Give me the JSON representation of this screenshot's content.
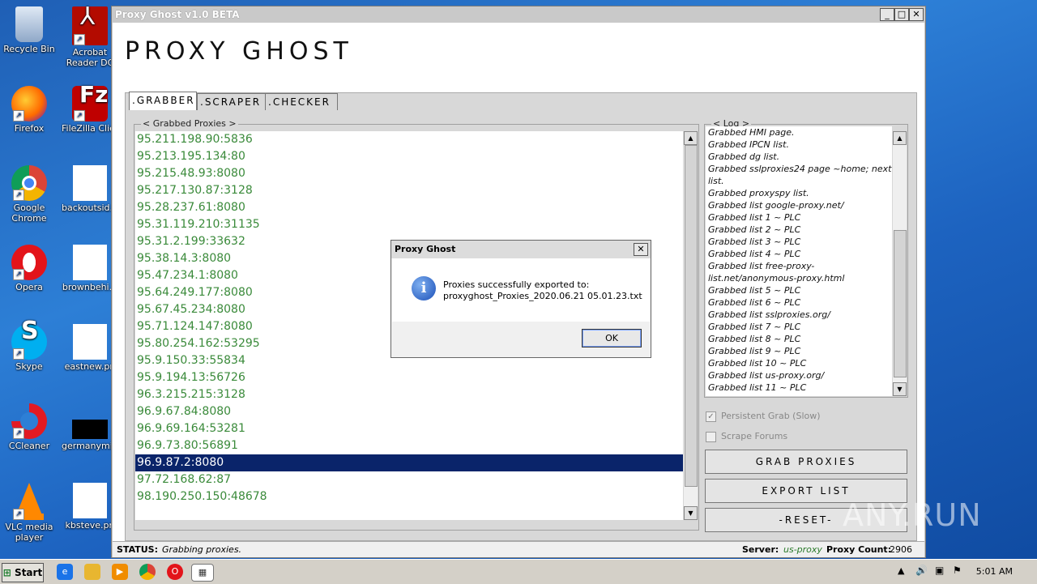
{
  "desktop": {
    "icons": [
      {
        "label": "Recycle Bin",
        "icon": "recycle-bin-icon"
      },
      {
        "label": "Acrobat Reader DC",
        "icon": "acrobat-icon"
      },
      {
        "label": "Firefox",
        "icon": "firefox-icon"
      },
      {
        "label": "FileZilla Client",
        "icon": "filezilla-icon"
      },
      {
        "label": "Google Chrome",
        "icon": "chrome-icon"
      },
      {
        "label": "backoutsid...",
        "icon": "file-icon"
      },
      {
        "label": "Opera",
        "icon": "opera-icon"
      },
      {
        "label": "brownbehi...",
        "icon": "file-icon"
      },
      {
        "label": "Skype",
        "icon": "skype-icon"
      },
      {
        "label": "eastnew.pn",
        "icon": "file-icon"
      },
      {
        "label": "CCleaner",
        "icon": "ccleaner-icon"
      },
      {
        "label": "germanymin...",
        "icon": "image-file-icon"
      },
      {
        "label": "VLC media player",
        "icon": "vlc-icon"
      },
      {
        "label": "kbsteve.pn",
        "icon": "file-icon"
      }
    ]
  },
  "window": {
    "title": "Proxy Ghost v1.0 BETA",
    "brand": "PROXY GHOST",
    "controls": {
      "minimize": "_",
      "maximize": "□",
      "close": "✕"
    }
  },
  "tabs": [
    {
      "label": ".GRABBER",
      "active": true
    },
    {
      "label": ".SCRAPER",
      "active": false
    },
    {
      "label": ".CHECKER",
      "active": false
    }
  ],
  "grabbed": {
    "legend": "< Grabbed Proxies >",
    "rows": [
      "95.211.198.90:5836",
      "95.213.195.134:80",
      "95.215.48.93:8080",
      "95.217.130.87:3128",
      "95.28.237.61:8080",
      "95.31.119.210:31135",
      "95.31.2.199:33632",
      "95.38.14.3:8080",
      "95.47.234.1:8080",
      "95.64.249.177:8080",
      "95.67.45.234:8080",
      "95.71.124.147:8080",
      "95.80.254.162:53295",
      "95.9.150.33:55834",
      "95.9.194.13:56726",
      "96.3.215.215:3128",
      "96.9.67.84:8080",
      "96.9.69.164:53281",
      "96.9.73.80:56891",
      "96.9.87.2:8080",
      "97.72.168.62:87",
      "98.190.250.150:48678"
    ],
    "selected_index": 19
  },
  "log": {
    "legend": "< Log >",
    "rows": [
      "Grabbed HMI page.",
      "Grabbed IPCN list.",
      "Grabbed dg list.",
      "Grabbed sslproxies24 page ~home; next",
      "list.",
      "Grabbed proxyspy list.",
      "Grabbed list google-proxy.net/",
      "Grabbed list 1 ~ PLC",
      "Grabbed list 2 ~ PLC",
      "Grabbed list 3 ~ PLC",
      "Grabbed list 4 ~ PLC",
      "Grabbed list free-proxy-",
      "list.net/anonymous-proxy.html",
      "Grabbed list 5 ~ PLC",
      "Grabbed list 6 ~ PLC",
      "Grabbed list sslproxies.org/",
      "Grabbed list 7 ~ PLC",
      "Grabbed list 8 ~ PLC",
      "Grabbed list 9 ~ PLC",
      "Grabbed list 10 ~ PLC",
      "Grabbed list us-proxy.org/",
      "Grabbed list 11 ~ PLC"
    ]
  },
  "options": {
    "persistent_grab": {
      "label": "Persistent Grab (Slow)",
      "checked": true
    },
    "scrape_forums": {
      "label": "Scrape Forums",
      "checked": false
    }
  },
  "buttons": {
    "grab": "GRAB PROXIES",
    "export": "EXPORT LIST",
    "reset": "-RESET-"
  },
  "status": {
    "label": "STATUS:",
    "value": "Grabbing proxies.",
    "server_label": "Server:",
    "server_value": "us-proxy",
    "count_label": "Proxy Count:",
    "count_value": "2906"
  },
  "dialog": {
    "title": "Proxy Ghost",
    "message_line1": "Proxies successfully exported to:",
    "message_line2": "proxyghost_Proxies_2020.06.21 05.01.23.txt",
    "ok": "OK",
    "close": "✕",
    "icon": "info-icon"
  },
  "taskbar": {
    "start": "Start",
    "clock": "5:01 AM"
  },
  "watermark": "ANY.RUN",
  "colors": {
    "proxy_text": "#3a8a3a",
    "selection": "#0a246a",
    "desktop": "#1f6fc8"
  }
}
